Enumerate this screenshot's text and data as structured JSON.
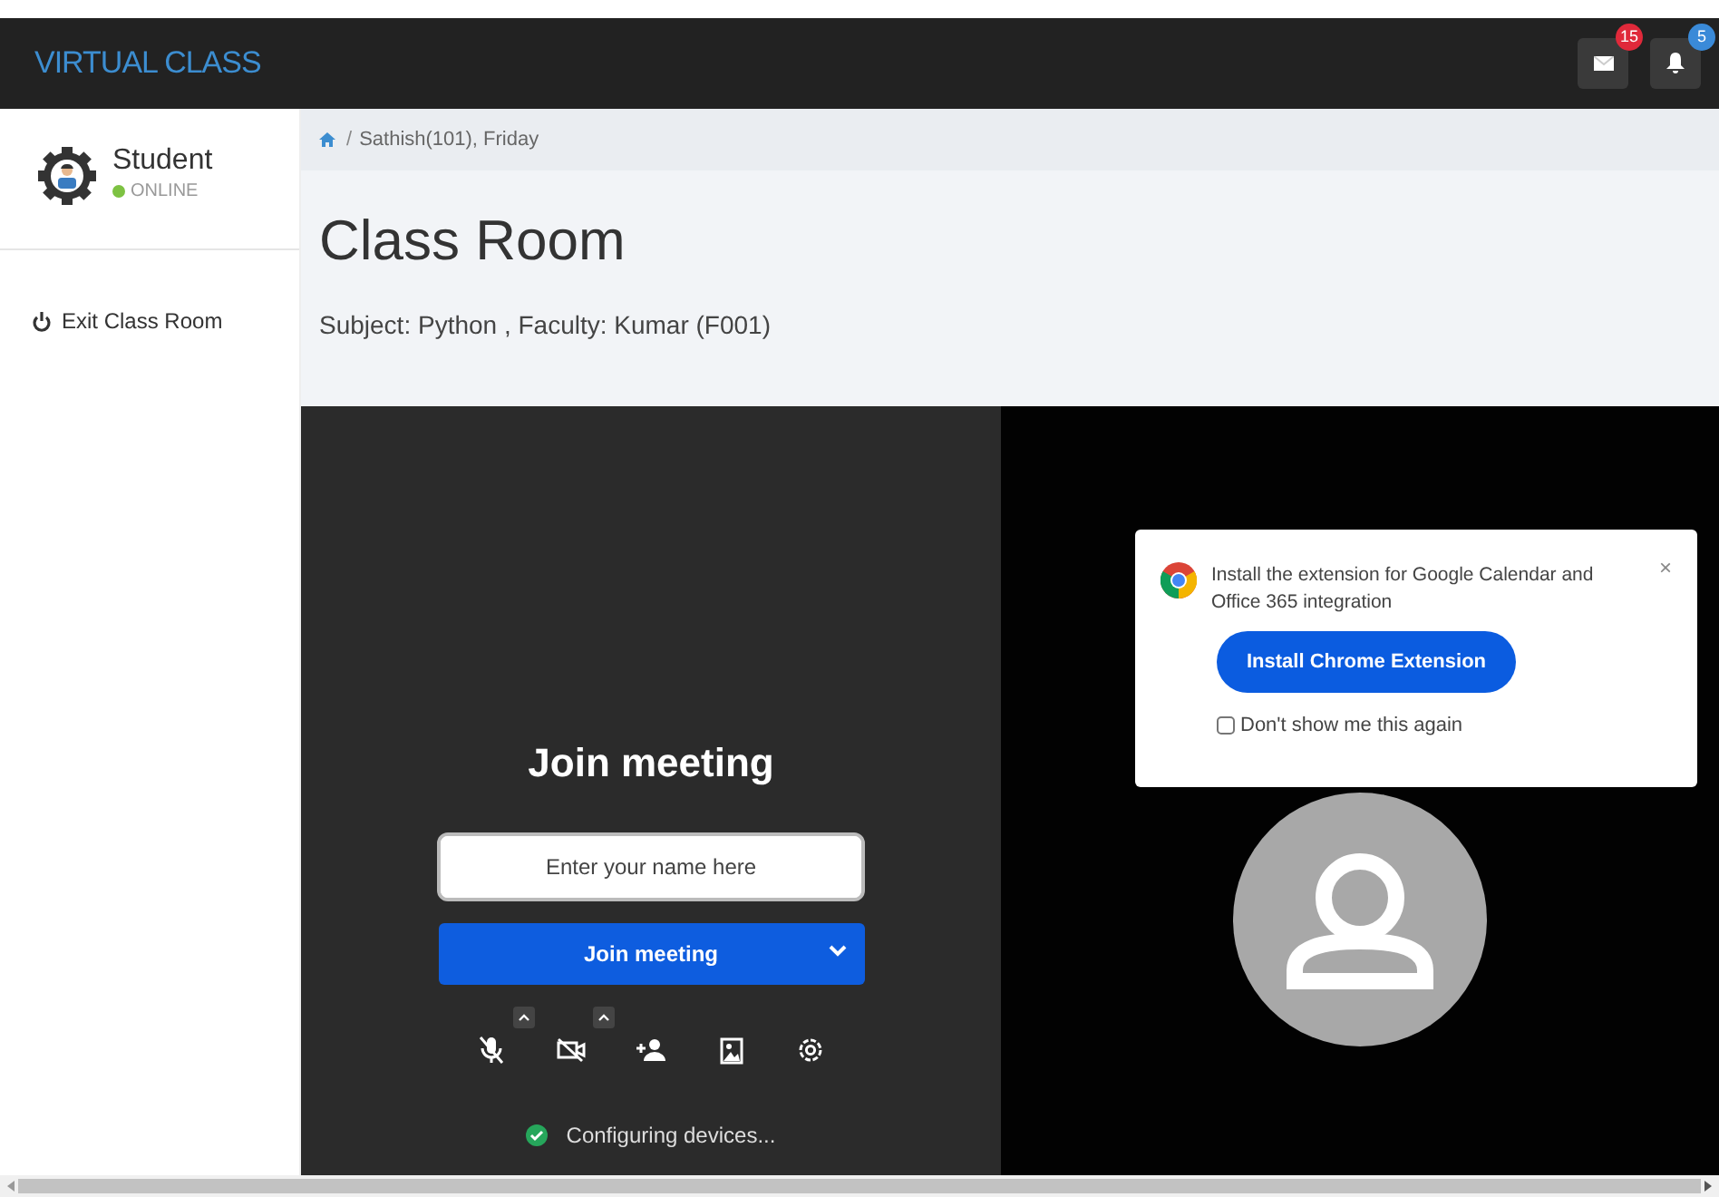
{
  "navbar": {
    "brand": "VIRTUAL CLASS",
    "messages_count": "15",
    "notifications_count": "5"
  },
  "sidebar": {
    "user": "Student",
    "status": "ONLINE",
    "items": [
      {
        "label": "Exit Class Room"
      }
    ]
  },
  "breadcrumb": {
    "separator": "/",
    "items": [
      "Sathish(101), Friday"
    ]
  },
  "header": {
    "title": "Class Room",
    "subtitle": "Subject: Python , Faculty: Kumar (F001)"
  },
  "meeting": {
    "title": "Join meeting",
    "name_field": {
      "placeholder": "Enter your name here"
    },
    "join_button": "Join meeting",
    "status": "Configuring devices..."
  },
  "popup": {
    "message": "Install the extension for Google Calendar and Office 365 integration",
    "close": "×",
    "button": "Install Chrome Extension",
    "checkbox": {
      "label": "Don't show me this again",
      "checked": false
    }
  }
}
